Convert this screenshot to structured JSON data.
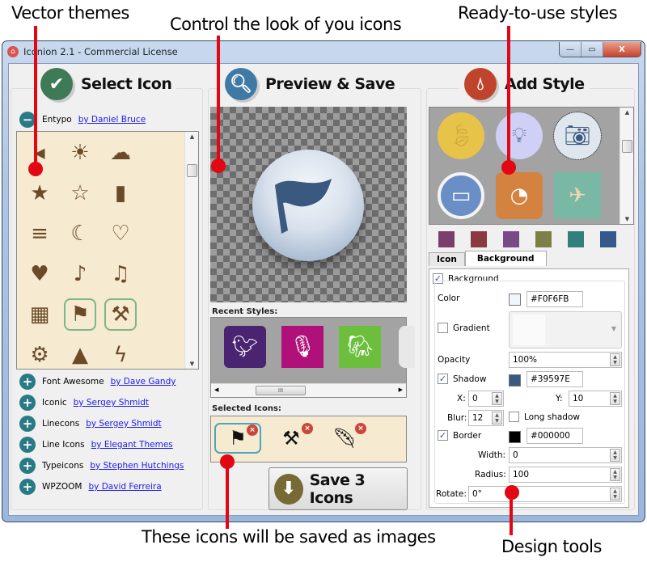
{
  "callouts": {
    "vector_themes": "Vector themes",
    "control_look": "Control the look of you icons",
    "ready_styles": "Ready-to-use styles",
    "saved_as_images": "These icons will be saved as images",
    "design_tools": "Design tools"
  },
  "window": {
    "title": "Iconion 2.1 - Commercial License",
    "minimize": "—",
    "maximize": "▭",
    "close": "X"
  },
  "select_panel": {
    "title": "Select Icon",
    "active_library": {
      "name": "Entypo",
      "author": "by Daniel Bruce",
      "toggle": "−"
    },
    "glyphs": [
      [
        "video-icon",
        "contrast-icon",
        "cloud-icon"
      ],
      [
        "star-filled-icon",
        "star-outline-icon",
        "cup-icon"
      ],
      [
        "menu-icon",
        "moon-icon",
        "heart-outline-icon"
      ],
      [
        "heart-filled-icon",
        "note-icon",
        "music-icon"
      ],
      [
        "grid-icon",
        "flag-icon",
        "tools-icon"
      ],
      [
        "gear-icon",
        "warning-icon",
        "bolt-icon"
      ]
    ],
    "libraries": [
      {
        "name": "Font Awesome",
        "author": "by Dave Gandy",
        "toggle": "+"
      },
      {
        "name": "Iconic",
        "author": "by Sergey Shmidt",
        "toggle": "+"
      },
      {
        "name": "Linecons",
        "author": "by Sergey Shmidt",
        "toggle": "+"
      },
      {
        "name": "Line Icons",
        "author": "by Elegant Themes",
        "toggle": "+"
      },
      {
        "name": "Typeicons",
        "author": "by Stephen Hutchings",
        "toggle": "+"
      },
      {
        "name": "WPZOOM",
        "author": "by David Ferreira",
        "toggle": "+"
      }
    ]
  },
  "preview_panel": {
    "title": "Preview & Save",
    "recent_styles_label": "Recent Styles:",
    "recent_styles": [
      {
        "name": "twitter-style",
        "color": "#4a2470"
      },
      {
        "name": "microphone-style",
        "color": "#b0107a"
      },
      {
        "name": "evernote-style",
        "color": "#6cbe3d"
      }
    ],
    "selected_icons_label": "Selected Icons:",
    "selected_icons": [
      "flag-icon",
      "tools-icon",
      "feather-icon"
    ],
    "save_button": "Save 3 Icons"
  },
  "style_panel": {
    "title": "Add Style",
    "styles": [
      {
        "name": "leaf-style",
        "color": "#e8c34a"
      },
      {
        "name": "bulb-style",
        "color": "#d0d0f6"
      },
      {
        "name": "camera-style",
        "color": "#dfe6ee"
      },
      {
        "name": "battery-style",
        "color": "#6a8fc6"
      },
      {
        "name": "chart-style",
        "color": "#d4823f"
      },
      {
        "name": "plane-style",
        "color": "#78b8a4"
      }
    ],
    "swatches": [
      "#7a3f6b",
      "#8a3a40",
      "#7a4a86",
      "#7a8046",
      "#327f7c",
      "#355a8a"
    ],
    "tabs": [
      "Icon",
      "Background"
    ],
    "active_tab": "Background",
    "background": {
      "enabled_label": "Background",
      "color_label": "Color",
      "color_value": "#F0F6FB",
      "gradient_label": "Gradient",
      "opacity_label": "Opacity",
      "opacity_value": "100%",
      "shadow_label": "Shadow",
      "shadow_color": "#39597E",
      "x_label": "X:",
      "x_value": "0",
      "y_label": "Y:",
      "y_value": "10",
      "blur_label": "Blur:",
      "blur_value": "12",
      "long_shadow_label": "Long shadow",
      "border_label": "Border",
      "border_color": "#000000",
      "width_label": "Width:",
      "width_value": "0",
      "radius_label": "Radius:",
      "radius_value": "100",
      "rotate_label": "Rotate:",
      "rotate_value": "0°"
    }
  }
}
